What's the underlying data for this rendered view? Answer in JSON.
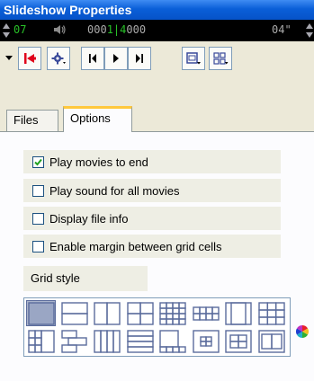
{
  "window": {
    "title": "Slideshow Properties"
  },
  "status": {
    "slide_number": "07",
    "counter_prefix": "000",
    "counter_current": "1|4",
    "counter_suffix": "000",
    "duration": "04\""
  },
  "toolbar": {
    "buttons": [
      {
        "name": "dropdown-caret-icon"
      },
      {
        "name": "go-to-first-icon"
      },
      {
        "name": "settings-gear-icon"
      },
      {
        "name": "previous-slide-icon"
      },
      {
        "name": "play-icon"
      },
      {
        "name": "next-slide-icon"
      },
      {
        "name": "single-view-icon"
      },
      {
        "name": "grid-view-icon"
      }
    ]
  },
  "tabs": [
    {
      "label": "Files",
      "active": false
    },
    {
      "label": "Options",
      "active": true
    }
  ],
  "options": [
    {
      "label": "Play movies to end",
      "checked": true
    },
    {
      "label": "Play sound for all movies",
      "checked": false
    },
    {
      "label": "Display file info",
      "checked": false
    },
    {
      "label": "Enable margin between grid cells",
      "checked": false
    }
  ],
  "grid_style": {
    "label": "Grid style",
    "selected_index": 0,
    "styles": [
      "single",
      "two-rows",
      "two-columns",
      "quad",
      "grid-4x4",
      "small-grid",
      "center-large",
      "grid-3x3",
      "grid-left-stack",
      "stair",
      "four-columns",
      "four-rows",
      "tile-corner",
      "center-small-grid",
      "pair-grid",
      "pair-columns"
    ]
  },
  "colors": {
    "title_bar": "#0a5fd8",
    "lcd_green": "#28c028",
    "accent_red": "#e0001a",
    "tab_highlight": "#ffc83c"
  }
}
